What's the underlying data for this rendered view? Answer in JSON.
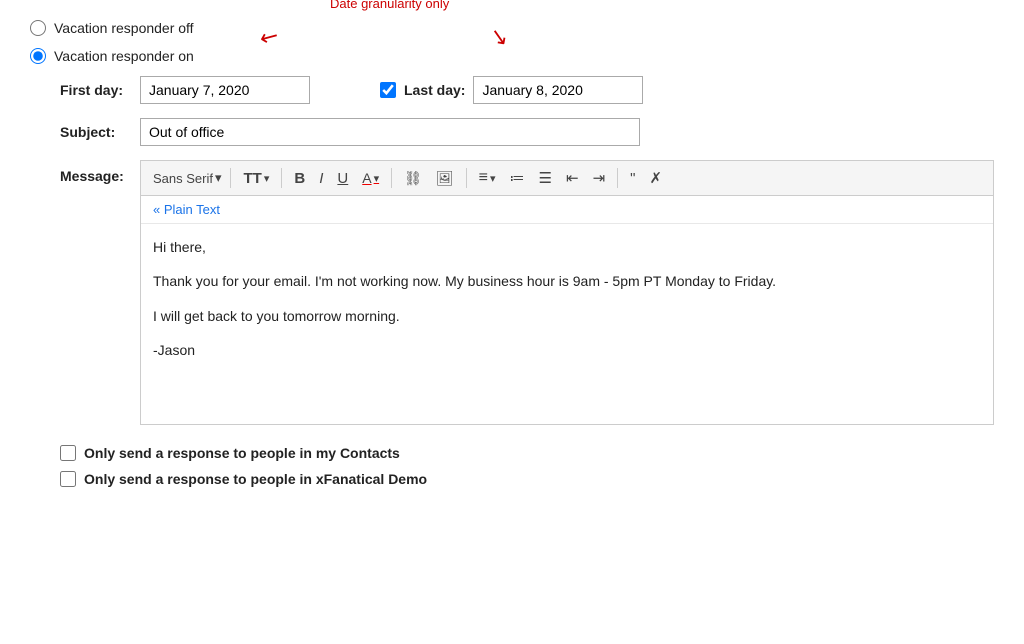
{
  "vacation_responder": {
    "off_label": "Vacation responder off",
    "on_label": "Vacation responder on",
    "first_day_label": "First day:",
    "first_day_value": "January 7, 2020",
    "last_day_label": "Last day:",
    "last_day_value": "January 8, 2020",
    "subject_label": "Subject:",
    "subject_value": "Out of office",
    "message_label": "Message:"
  },
  "annotation": {
    "callout_text": "Date granularity only"
  },
  "toolbar": {
    "font_name": "Sans Serif",
    "font_dropdown_icon": "▾",
    "text_size_icon": "TT",
    "text_size_dropdown": "▾",
    "bold_label": "B",
    "italic_label": "I",
    "underline_label": "U",
    "font_color_label": "A",
    "font_color_dropdown": "▾",
    "link_label": "🔗",
    "image_label": "🖼",
    "align_label": "≡",
    "align_dropdown": "▾",
    "numbered_list_label": "≔",
    "bullet_list_label": "☰",
    "indent_less_label": "⇤",
    "indent_more_label": "⇥",
    "blockquote_label": "❝",
    "clear_format_label": "✗"
  },
  "editor": {
    "plain_text_link": "« Plain Text",
    "message_line1": "Hi there,",
    "message_line2": "Thank you for your email. I'm not working now. My business hour is 9am - 5pm PT Monday to Friday.",
    "message_line3": "I will get back to you tomorrow morning.",
    "message_line4": "-Jason"
  },
  "checkboxes": {
    "contacts_label": "Only send a response to people in my Contacts",
    "xfanatical_label": "Only send a response to people in xFanatical Demo"
  }
}
